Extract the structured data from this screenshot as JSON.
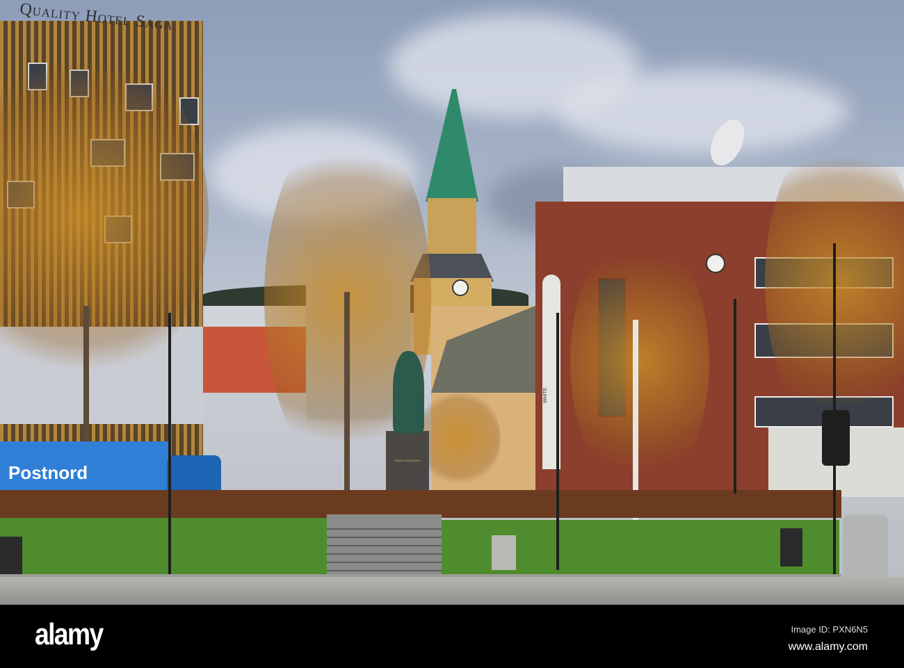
{
  "photo": {
    "hotel_sign": "Quality Hotel Saga",
    "truck_label": "Postnord",
    "statue_inscription": "ROALD AMUNDSEN",
    "sign_pillar_text": "WHITE"
  },
  "watermark": {
    "logo": "alamy",
    "image_id": "Image ID: PXN6N5",
    "site": "www.alamy.com"
  }
}
